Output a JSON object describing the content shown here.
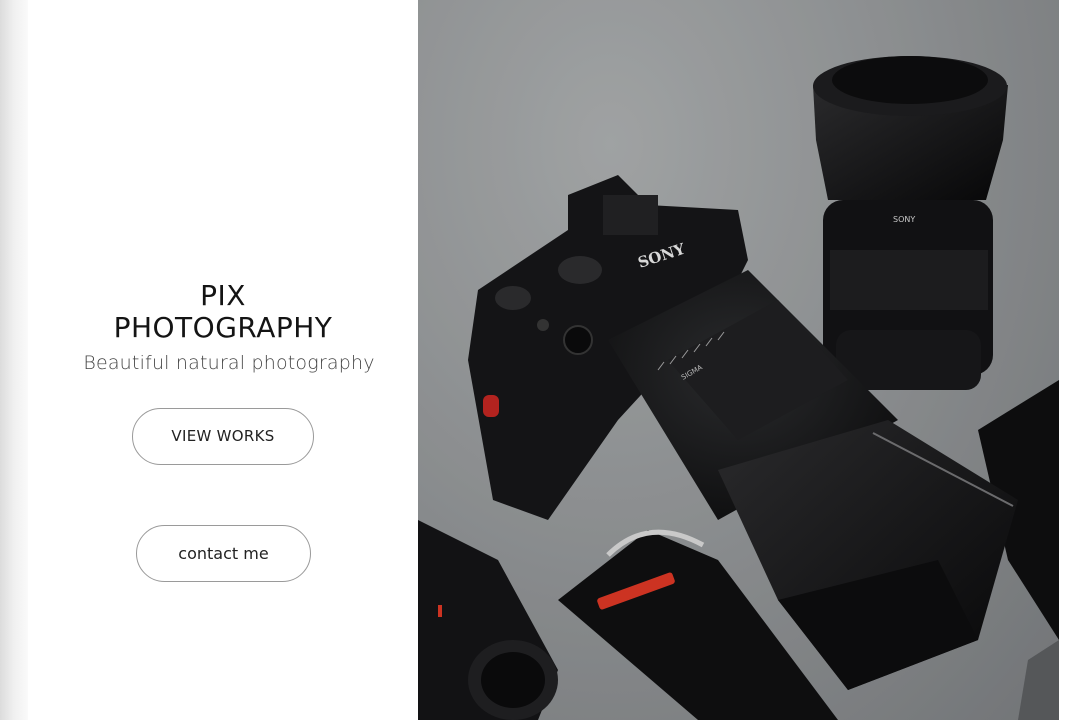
{
  "brand": {
    "title_line1": "PIX",
    "title_line2": "PHOTOGRAPHY",
    "tagline": "Beautiful natural photography"
  },
  "buttons": {
    "view_works": "VIEW WORKS",
    "contact": "contact me"
  },
  "hero": {
    "camera_brand": "SONY",
    "lens_brand": "SONY",
    "lens_maker": "SIGMA"
  }
}
